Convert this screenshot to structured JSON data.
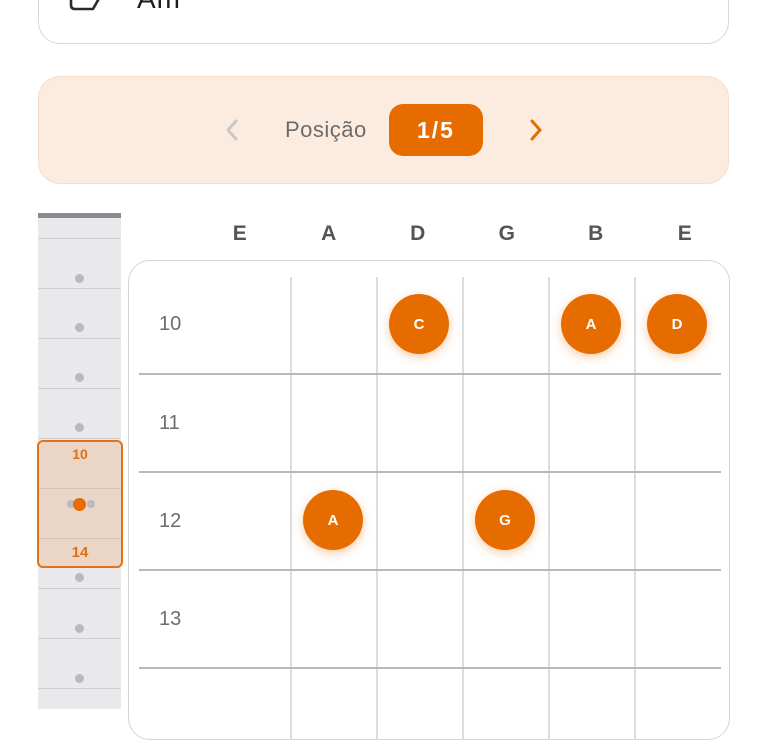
{
  "chord_card": {
    "chord_name": "Am"
  },
  "position_nav": {
    "label": "Posição",
    "current": "1",
    "total": "5",
    "display": "1/5",
    "prev_icon": "chevron-left-icon",
    "next_icon": "chevron-right-icon"
  },
  "mini_neck": {
    "window_start_fret": "10",
    "window_end_fret": "14"
  },
  "strings": [
    "E",
    "A",
    "D",
    "G",
    "B",
    "E"
  ],
  "frets": [
    "10",
    "11",
    "12",
    "13"
  ],
  "notes": [
    {
      "label": "C",
      "string": 2,
      "fret": "10"
    },
    {
      "label": "A",
      "string": 4,
      "fret": "10"
    },
    {
      "label": "D",
      "string": 5,
      "fret": "10"
    },
    {
      "label": "A",
      "string": 1,
      "fret": "12"
    },
    {
      "label": "G",
      "string": 3,
      "fret": "12"
    }
  ],
  "colors": {
    "accent": "#e66c00",
    "nav_background": "#fcece0",
    "neck_background": "#e9e9ec"
  }
}
